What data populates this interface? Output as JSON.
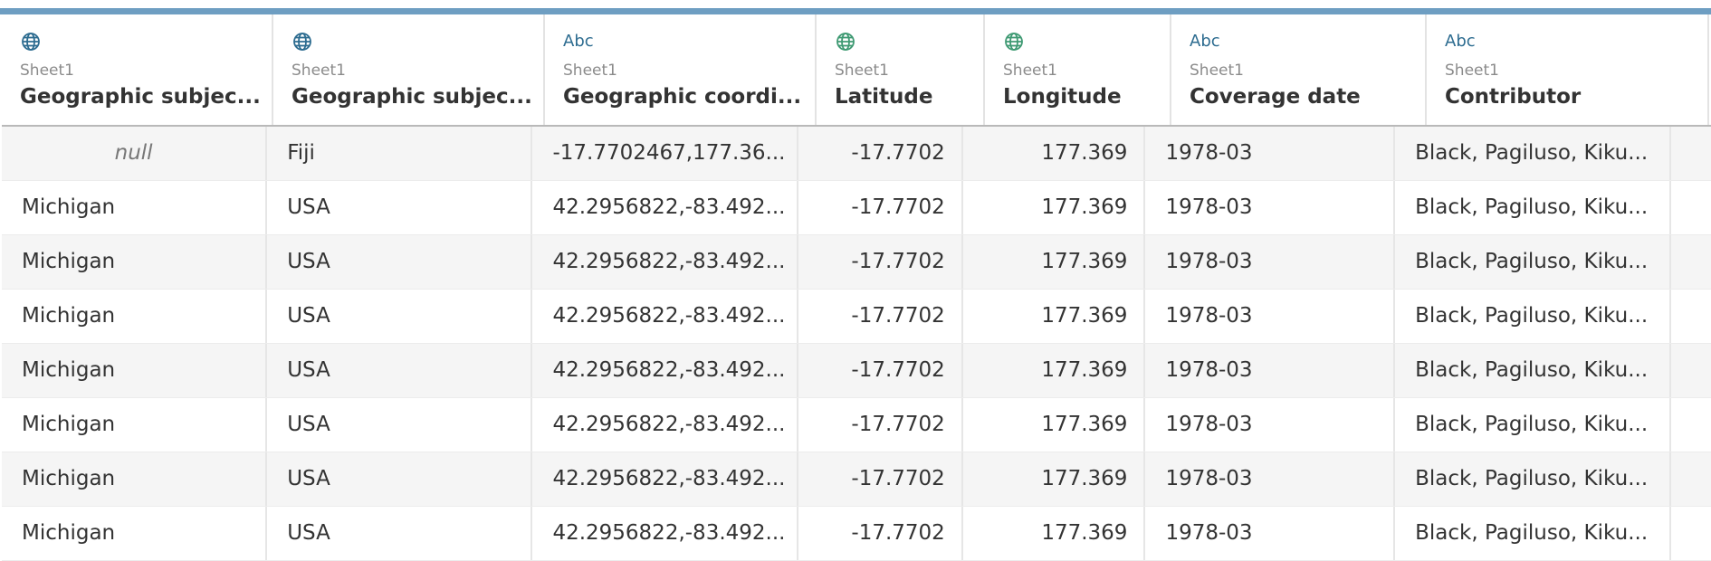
{
  "columns": [
    {
      "type": "globe-icon",
      "source": "Sheet1",
      "name": "Geographic subjec..."
    },
    {
      "type": "globe-icon",
      "source": "Sheet1",
      "name": "Geographic subjec..."
    },
    {
      "type": "Abc",
      "source": "Sheet1",
      "name": "Geographic coordi..."
    },
    {
      "type": "globe-icon",
      "source": "Sheet1",
      "name": "Latitude"
    },
    {
      "type": "globe-icon",
      "source": "Sheet1",
      "name": "Longitude"
    },
    {
      "type": "Abc",
      "source": "Sheet1",
      "name": "Coverage date"
    },
    {
      "type": "Abc",
      "source": "Sheet1",
      "name": "Contributor"
    }
  ],
  "rows": [
    [
      "null",
      "Fiji",
      "-17.7702467,177.36...",
      "-17.7702",
      "177.369",
      "1978-03",
      "Black, Pagiluso, Kiku..."
    ],
    [
      "Michigan",
      "USA",
      "42.2956822,-83.492...",
      "-17.7702",
      "177.369",
      "1978-03",
      "Black, Pagiluso, Kiku..."
    ],
    [
      "Michigan",
      "USA",
      "42.2956822,-83.492...",
      "-17.7702",
      "177.369",
      "1978-03",
      "Black, Pagiluso, Kiku..."
    ],
    [
      "Michigan",
      "USA",
      "42.2956822,-83.492...",
      "-17.7702",
      "177.369",
      "1978-03",
      "Black, Pagiluso, Kiku..."
    ],
    [
      "Michigan",
      "USA",
      "42.2956822,-83.492...",
      "-17.7702",
      "177.369",
      "1978-03",
      "Black, Pagiluso, Kiku..."
    ],
    [
      "Michigan",
      "USA",
      "42.2956822,-83.492...",
      "-17.7702",
      "177.369",
      "1978-03",
      "Black, Pagiluso, Kiku..."
    ],
    [
      "Michigan",
      "USA",
      "42.2956822,-83.492...",
      "-17.7702",
      "177.369",
      "1978-03",
      "Black, Pagiluso, Kiku..."
    ],
    [
      "Michigan",
      "USA",
      "42.2956822,-83.492...",
      "-17.7702",
      "177.369",
      "1978-03",
      "Black, Pagiluso, Kiku..."
    ]
  ],
  "colors": {
    "header_accent": "#6e9ec2",
    "globe_blue": "#2d6c90",
    "globe_green": "#3f9a73",
    "abc_type": "#2d6c90"
  }
}
